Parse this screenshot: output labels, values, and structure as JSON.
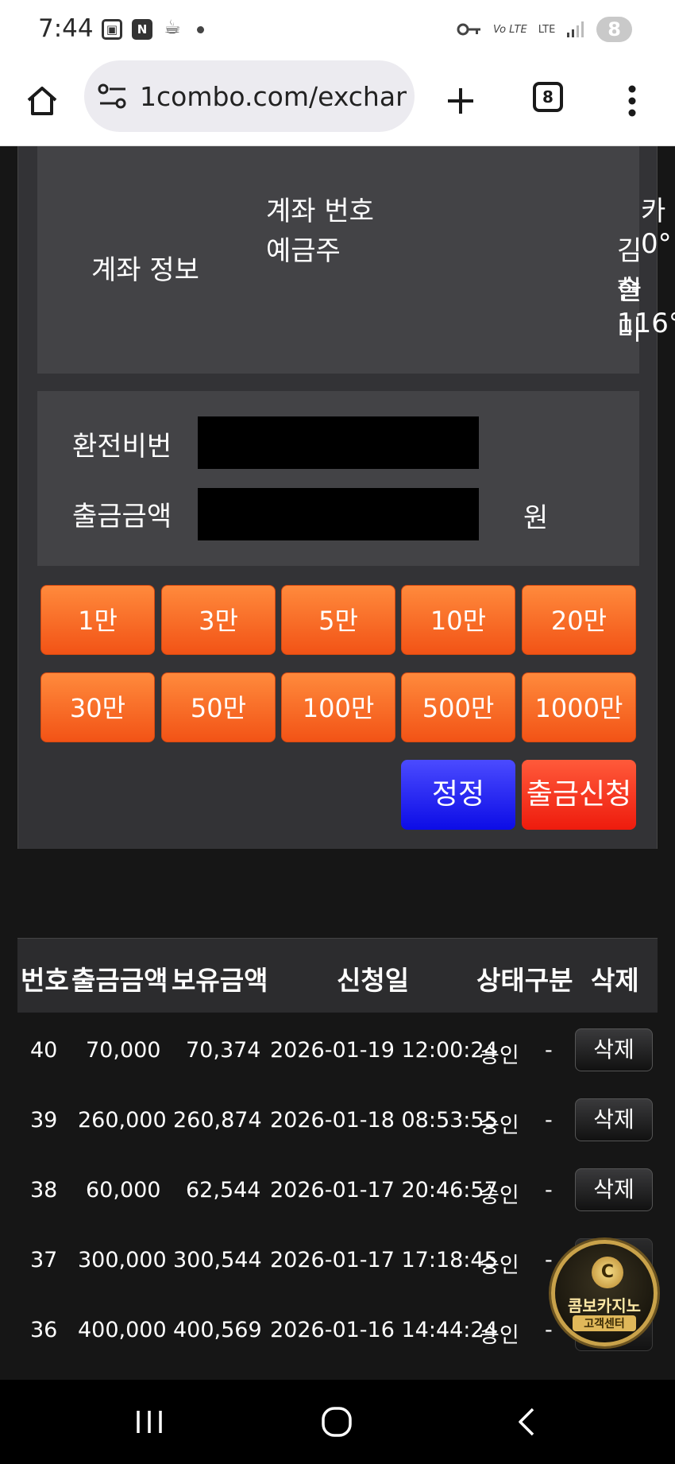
{
  "status_bar": {
    "time": "7:44",
    "icons": [
      "screenshot-icon",
      "n-icon",
      "coffee-icon",
      "dot-icon"
    ],
    "right_icons": [
      "key-icon",
      "volte-icon",
      "lte-icon",
      "signal-icon"
    ],
    "volte": "Vo LTE",
    "lte": "LTE",
    "battery": "8"
  },
  "browser": {
    "url": "1combo.com/exchan",
    "tab_count": "8"
  },
  "account": {
    "title": "계좌 정보",
    "field_number_label": "계좌 번호",
    "field_holder_label": "예금주",
    "value_number": "카 0°",
    "value_holder_line1": "김슬",
    "value_holder_line2": "현116°",
    "value_holder_line3": "미"
  },
  "form": {
    "password_label": "환전비번",
    "password_value": "",
    "amount_label": "출금금액",
    "amount_value": "",
    "unit": "원"
  },
  "amount_buttons": [
    "1만",
    "3만",
    "5만",
    "10만",
    "20만",
    "30만",
    "50만",
    "100만",
    "500만",
    "1000만"
  ],
  "actions": {
    "edit": "정정",
    "apply": "출금신청"
  },
  "table": {
    "headers": {
      "no": "번호",
      "withdraw": "출금금액",
      "balance": "보유금액",
      "date": "신청일",
      "status": "상태구분",
      "delete": "삭제"
    },
    "rows": [
      {
        "no": "40",
        "withdraw": "70,000",
        "balance": "70,374",
        "date": "2026-01-19 12:00:24",
        "status": "승인",
        "type": "-",
        "del": "삭제"
      },
      {
        "no": "39",
        "withdraw": "260,000",
        "balance": "260,874",
        "date": "2026-01-18 08:53:55",
        "status": "승인",
        "type": "-",
        "del": "삭제"
      },
      {
        "no": "38",
        "withdraw": "60,000",
        "balance": "62,544",
        "date": "2026-01-17 20:46:57",
        "status": "승인",
        "type": "-",
        "del": "삭제"
      },
      {
        "no": "37",
        "withdraw": "300,000",
        "balance": "300,544",
        "date": "2026-01-17 17:18:45",
        "status": "승인",
        "type": "-",
        "del": ""
      },
      {
        "no": "36",
        "withdraw": "400,000",
        "balance": "400,569",
        "date": "2026-01-16 14:44:24",
        "status": "승인",
        "type": "-",
        "del": ""
      }
    ]
  },
  "cs_badge": {
    "title": "콤보카지노",
    "subtitle": "고객센터"
  }
}
